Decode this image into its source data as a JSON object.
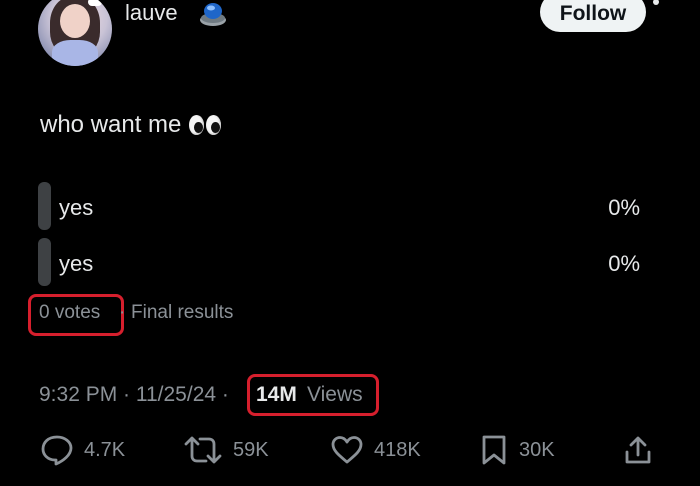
{
  "header": {
    "username": "lauve",
    "follow_label": "Follow"
  },
  "post": {
    "text": "who want me"
  },
  "poll": {
    "options": [
      {
        "label": "yes",
        "percent": "0%"
      },
      {
        "label": "yes",
        "percent": "0%"
      }
    ],
    "votes": "0 votes",
    "separator": "·",
    "status": "Final results"
  },
  "meta": {
    "timestamp": "9:32 PM · 11/25/24 ·",
    "views_count": "14M",
    "views_label": "Views"
  },
  "actions": {
    "replies": "4.7K",
    "reposts": "59K",
    "likes": "418K",
    "bookmarks": "30K"
  },
  "colors": {
    "background": "#000000",
    "text": "#e7e9ea",
    "muted": "#8b9197",
    "highlight": "#d61f2d",
    "poll_bar": "#3e4144"
  }
}
